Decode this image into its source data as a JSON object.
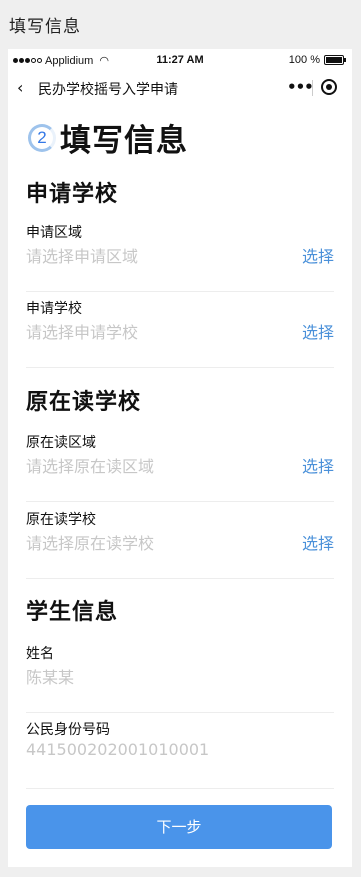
{
  "page_heading": "填写信息",
  "status_bar": {
    "carrier": "Applidium",
    "time": "11:27 AM",
    "battery": "100 %"
  },
  "nav": {
    "title": "民办学校摇号入学申请"
  },
  "step": {
    "number": "2",
    "title": "填写信息"
  },
  "sections": {
    "apply_school": {
      "title": "申请学校"
    },
    "current_school": {
      "title": "原在读学校"
    },
    "student": {
      "title": "学生信息"
    }
  },
  "fields": {
    "apply_region": {
      "label": "申请区域",
      "value": "请选择申请区域",
      "action": "选择"
    },
    "apply_school": {
      "label": "申请学校",
      "value": "请选择申请学校",
      "action": "选择"
    },
    "current_region": {
      "label": "原在读区域",
      "value": "请选择原在读区域",
      "action": "选择"
    },
    "current_school": {
      "label": "原在读学校",
      "value": "请选择原在读学校",
      "action": "选择"
    },
    "name": {
      "label": "姓名",
      "value": "陈某某"
    },
    "id_number": {
      "label": "公民身份号码",
      "value": "441500202001010001"
    }
  },
  "buttons": {
    "next": "下一步"
  },
  "colors": {
    "accent": "#4a94ea",
    "link": "#4a90d9",
    "placeholder": "#c7c7c7"
  }
}
